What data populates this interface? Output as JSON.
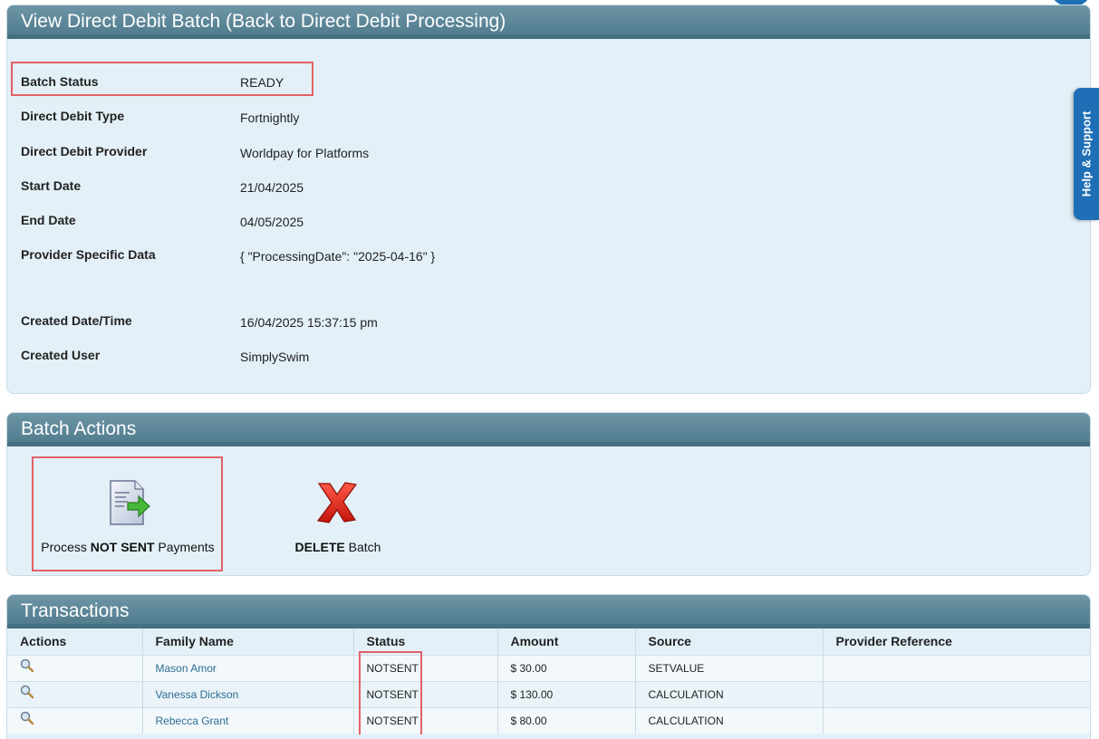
{
  "details_panel": {
    "title": "View Direct Debit Batch (Back to Direct Debit Processing)",
    "rows": [
      {
        "label": "Batch Status",
        "value": "READY"
      },
      {
        "label": "Direct Debit Type",
        "value": "Fortnightly"
      },
      {
        "label": "Direct Debit Provider",
        "value": "Worldpay for Platforms"
      },
      {
        "label": "Start Date",
        "value": "21/04/2025"
      },
      {
        "label": "End Date",
        "value": "04/05/2025"
      },
      {
        "label": "Provider Specific Data",
        "value": "{ \"ProcessingDate\": \"2025-04-16\" }"
      },
      {
        "label": "Created Date/Time",
        "value": "16/04/2025 15:37:15 pm"
      },
      {
        "label": "Created User",
        "value": "SimplySwim"
      }
    ]
  },
  "actions_panel": {
    "title": "Batch Actions",
    "process": {
      "prefix": "Process ",
      "bold": "NOT SENT",
      "suffix": " Payments",
      "icon": "process-payments-icon"
    },
    "delete": {
      "bold": "DELETE",
      "suffix": " Batch",
      "icon": "delete-x-icon"
    }
  },
  "transactions_panel": {
    "title": "Transactions",
    "columns": [
      "Actions",
      "Family Name",
      "Status",
      "Amount",
      "Source",
      "Provider Reference"
    ],
    "rows": [
      {
        "family": "Mason Amor",
        "status": "NOTSENT",
        "amount": "$ 30.00",
        "source": "SETVALUE",
        "reference": ""
      },
      {
        "family": "Vanessa Dickson",
        "status": "NOTSENT",
        "amount": "$ 130.00",
        "source": "CALCULATION",
        "reference": ""
      },
      {
        "family": "Rebecca Grant",
        "status": "NOTSENT",
        "amount": "$ 80.00",
        "source": "CALCULATION",
        "reference": ""
      }
    ]
  },
  "help_tab": {
    "label": "Help & Support"
  },
  "colors": {
    "header": "#5a8596",
    "panel_bg": "#e3f0f7",
    "highlight": "#e26167",
    "help_blue": "#1f6fb6",
    "link": "#2c6d92"
  }
}
